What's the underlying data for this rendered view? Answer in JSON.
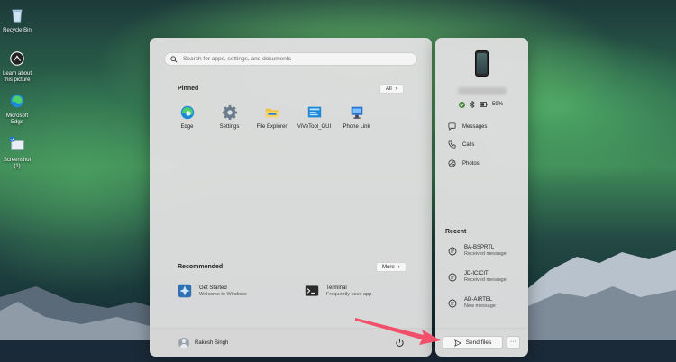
{
  "desktop": {
    "icons": [
      {
        "label": "Recycle Bin"
      },
      {
        "label": "Learn about this picture"
      },
      {
        "label": "Microsoft Edge"
      },
      {
        "label": "Screenshot (1)"
      }
    ]
  },
  "start": {
    "search_placeholder": "Search for apps, settings, and documents",
    "pinned_title": "Pinned",
    "all_label": "All",
    "pinned_apps": [
      {
        "label": "Edge",
        "icon": "edge-icon"
      },
      {
        "label": "Settings",
        "icon": "gear-icon"
      },
      {
        "label": "File Explorer",
        "icon": "folder-icon"
      },
      {
        "label": "ViVeTool_GUI",
        "icon": "vivetool-icon"
      },
      {
        "label": "Phone Link",
        "icon": "phone-link-icon"
      }
    ],
    "recommended_title": "Recommended",
    "more_label": "More",
    "recommended": [
      {
        "title": "Get Started",
        "subtitle": "Welcome to Windows"
      },
      {
        "title": "Terminal",
        "subtitle": "Frequently used app"
      }
    ],
    "user_name": "Rakesh Singh"
  },
  "phone": {
    "battery": "59%",
    "links": [
      {
        "label": "Messages",
        "icon": "messages-icon"
      },
      {
        "label": "Calls",
        "icon": "phone-icon"
      },
      {
        "label": "Photos",
        "icon": "photos-icon"
      }
    ],
    "recent_title": "Recent",
    "recent": [
      {
        "title": "BA-BSPRTL",
        "subtitle": "Received message"
      },
      {
        "title": "JD-ICICIT",
        "subtitle": "Received message"
      },
      {
        "title": "AD-AIRTEL",
        "subtitle": "New message"
      }
    ],
    "send_files_label": "Send files",
    "more_label": "···"
  },
  "colors": {
    "accent": "#0067c0",
    "arrow": "#f2506a"
  }
}
